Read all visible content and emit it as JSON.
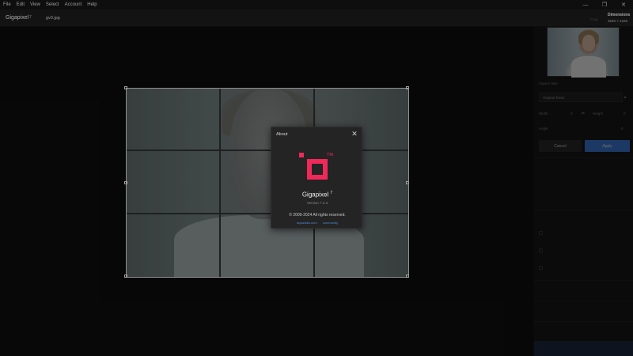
{
  "menubar": {
    "items": [
      "File",
      "Edit",
      "View",
      "Select",
      "Account",
      "Help"
    ]
  },
  "window_controls": {
    "minimize": "—",
    "restore": "❐",
    "close": "✕"
  },
  "header": {
    "app_name": "Gigapixel",
    "app_version": "7",
    "filename": "gv0.jpg",
    "dimensions_status": "Crop",
    "dimensions_title": "Dimensions",
    "dimensions_value": "3240 × 2160"
  },
  "sidebar": {
    "aspect_ratio_label": "Aspect ratio",
    "aspect_ratio_value": "Original Ratio",
    "width_label": "Width",
    "width_value": "0",
    "height_label": "Height",
    "height_value": "0",
    "angle_label": "Angle",
    "angle_value": "0",
    "cancel_label": "Cancel",
    "apply_label": "Apply"
  },
  "dialog": {
    "title": "About",
    "close_glyph": "✕",
    "trademark": "TM",
    "app_name": "Gigapixel",
    "app_version_major": "7",
    "version_text": "Version 7.2.3",
    "copyright": "© 2009-2024 All rights reserved.",
    "link_website": "topazlabs.com",
    "link_community": "community"
  },
  "colors": {
    "logo_pink": "#f0295a",
    "apply_blue": "#3d78d6",
    "link_blue": "#4d8ae0"
  }
}
